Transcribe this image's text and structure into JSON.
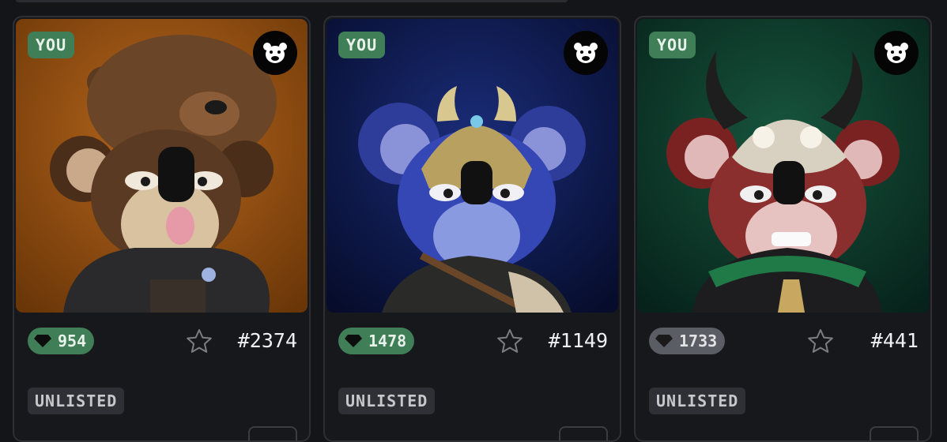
{
  "cards": [
    {
      "badge": "YOU",
      "logo_icon": "bear-logo-icon",
      "price": "954",
      "price_state": "green",
      "token": "#2374",
      "status": "UNLISTED",
      "background": "#8a4a12",
      "accent": "#5c3a22"
    },
    {
      "badge": "YOU",
      "logo_icon": "bear-logo-icon",
      "price": "1478",
      "price_state": "green",
      "token": "#1149",
      "status": "UNLISTED",
      "background": "#0e1a4a",
      "accent": "#3a50b8"
    },
    {
      "badge": "YOU",
      "logo_icon": "bear-logo-icon",
      "price": "1733",
      "price_state": "gray",
      "token": "#441",
      "status": "UNLISTED",
      "background": "#0e3a2a",
      "accent": "#8a2a2a"
    }
  ],
  "colors": {
    "page_bg": "#141519",
    "card_border": "#2d2f34",
    "green_pill": "#3f7e57",
    "gray_pill": "#5a5d63",
    "status_bg": "#2e3035"
  }
}
